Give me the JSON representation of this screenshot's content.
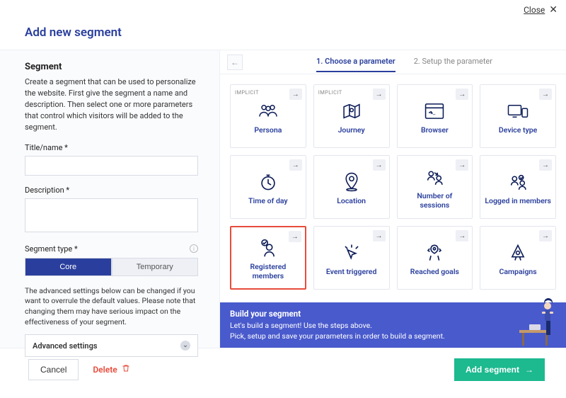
{
  "topbar": {
    "close": "Close"
  },
  "title": "Add new segment",
  "left": {
    "heading": "Segment",
    "description": "Create a segment that can be used to personalize the website. First give the segment a name and description. Then select one or more parameters that control which visitors will be added to the segment.",
    "title_label": "Title/name *",
    "title_value": "",
    "desc_label": "Description *",
    "desc_value": "",
    "segtype_label": "Segment type *",
    "segtype_core": "Core",
    "segtype_temp": "Temporary",
    "adv_note": "The advanced settings below can be changed if you want to overrule the default values. Please note that changing them may have serious impact on the effectiveness of your segment.",
    "adv_settings": "Advanced settings"
  },
  "right": {
    "step1": "1. Choose a parameter",
    "step2": "2. Setup the parameter",
    "implicit_tag": "IMPLICIT",
    "cards": [
      {
        "label": "Persona",
        "implicit": true
      },
      {
        "label": "Journey",
        "implicit": true
      },
      {
        "label": "Browser"
      },
      {
        "label": "Device type"
      },
      {
        "label": "Time of day"
      },
      {
        "label": "Location"
      },
      {
        "label": "Number of sessions"
      },
      {
        "label": "Logged in members"
      },
      {
        "label": "Registered members",
        "selected": true
      },
      {
        "label": "Event triggered"
      },
      {
        "label": "Reached goals"
      },
      {
        "label": "Campaigns"
      }
    ],
    "banner": {
      "title": "Build your segment",
      "line1": "Let's build a segment! Use the steps above.",
      "line2": "Pick, setup and save your parameters in order to build a segment."
    }
  },
  "footer": {
    "cancel": "Cancel",
    "delete": "Delete",
    "add": "Add segment"
  }
}
